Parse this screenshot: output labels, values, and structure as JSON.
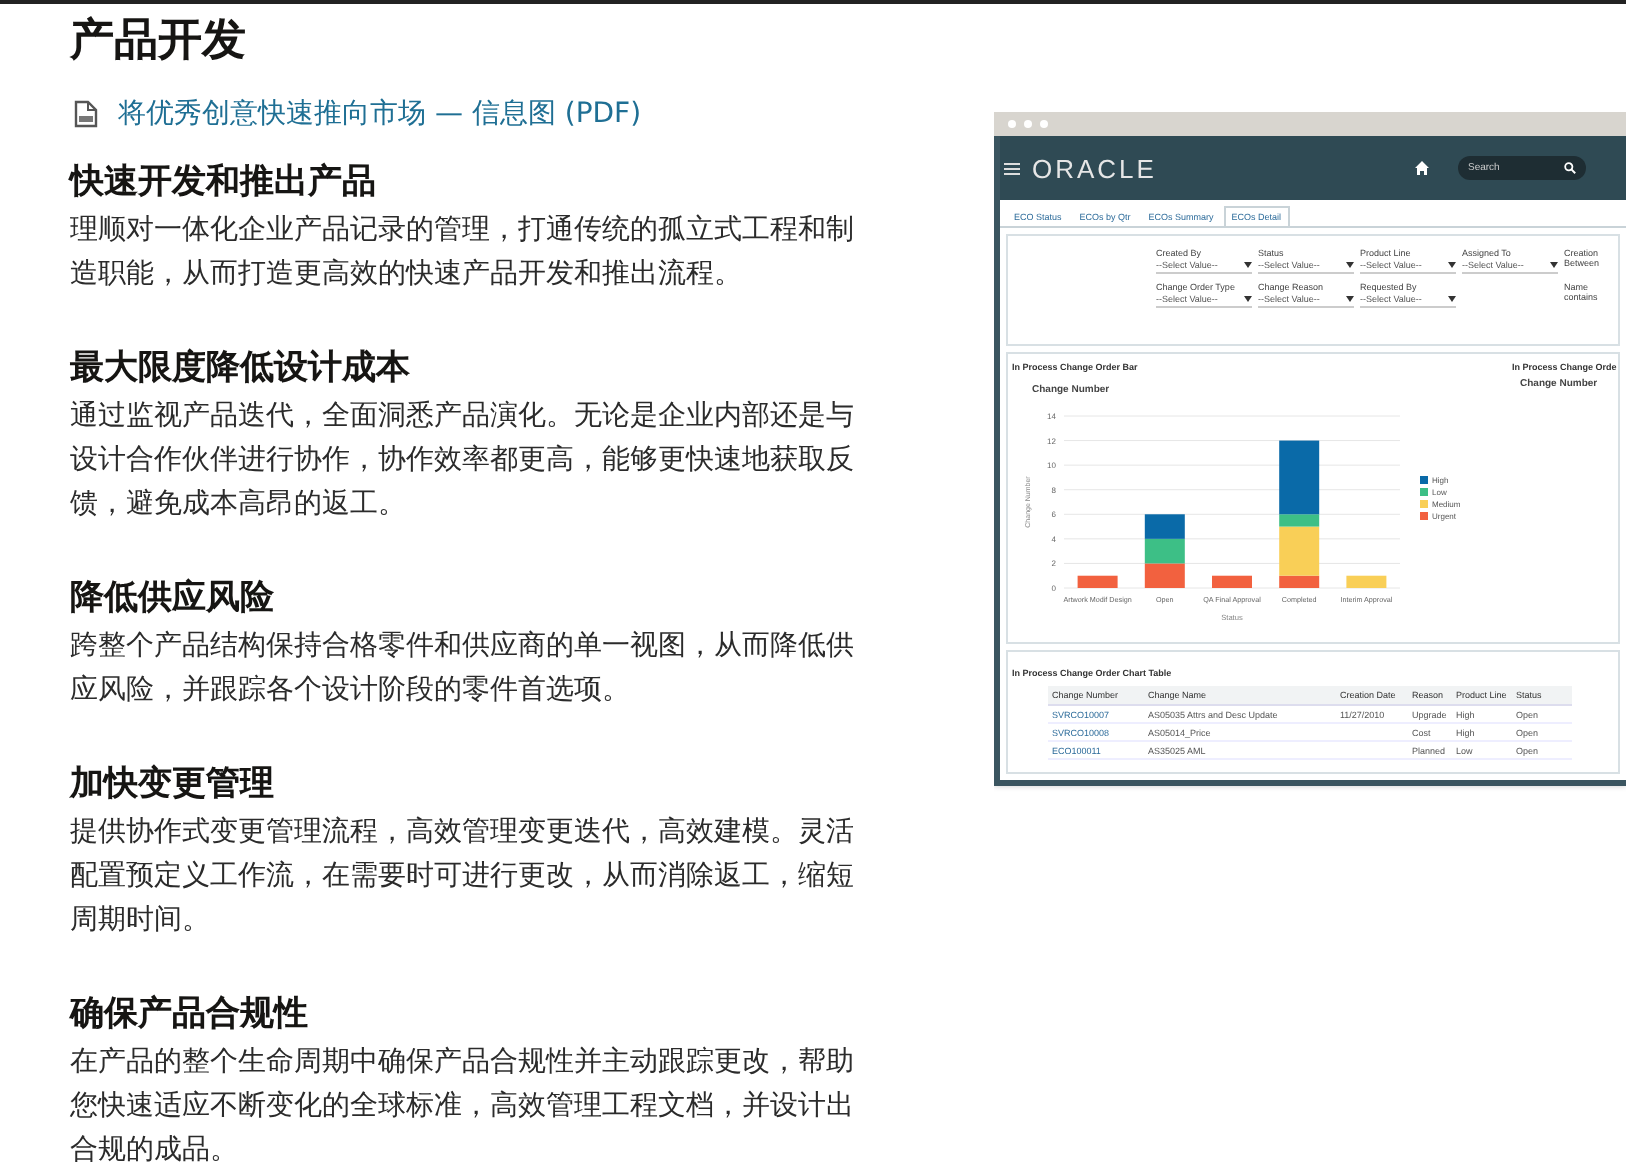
{
  "page": {
    "title": "产品开发",
    "pdf_link": "将优秀创意快速推向市场 — 信息图 (PDF)"
  },
  "sections": [
    {
      "heading": "快速开发和推出产品",
      "body": "理顺对一体化企业产品记录的管理，打通传统的孤立式工程和制造职能，从而打造更高效的快速产品开发和推出流程。"
    },
    {
      "heading": "最大限度降低设计成本",
      "body": "通过监视产品迭代，全面洞悉产品演化。无论是企业内部还是与设计合作伙伴进行协作，协作效率都更高，能够更快速地获取反馈，避免成本高昂的返工。"
    },
    {
      "heading": "降低供应风险",
      "body": "跨整个产品结构保持合格零件和供应商的单一视图，从而降低供应风险，并跟踪各个设计阶段的零件首选项。"
    },
    {
      "heading": "加快变更管理",
      "body": "提供协作式变更管理流程，高效管理变更迭代，高效建模。灵活配置预定义工作流，在需要时可进行更改，从而消除返工，缩短周期时间。"
    },
    {
      "heading": "确保产品合规性",
      "body": "在产品的整个生命周期中确保产品合规性并主动跟踪更改，帮助您快速适应不断变化的全球标准，高效管理工程文档，并设计出合规的成品。"
    }
  ],
  "mockup": {
    "logo": "ORACLE",
    "search": {
      "placeholder": "Search"
    },
    "tabs": [
      {
        "label": "ECO Status",
        "selected": false
      },
      {
        "label": "ECOs by Qtr",
        "selected": false
      },
      {
        "label": "ECOs Summary",
        "selected": false
      },
      {
        "label": "ECOs Detail",
        "selected": true
      }
    ],
    "filters": [
      {
        "kind": "select",
        "label": "Created By",
        "value": "--Select Value--"
      },
      {
        "kind": "select",
        "label": "Status",
        "value": "--Select Value--"
      },
      {
        "kind": "select",
        "label": "Product Line",
        "value": "--Select Value--"
      },
      {
        "kind": "select",
        "label": "Assigned To",
        "value": "--Select Value--"
      },
      {
        "kind": "text",
        "label": "Creation",
        "value": "Between"
      },
      {
        "kind": "select",
        "label": "Change Order Type",
        "value": "--Select Value--"
      },
      {
        "kind": "select",
        "label": "Change Reason",
        "value": "--Select Value--"
      },
      {
        "kind": "select",
        "label": "Requested By",
        "value": "--Select Value--"
      },
      {
        "kind": "empty"
      },
      {
        "kind": "text",
        "label": "Name",
        "value": "contains"
      }
    ],
    "chart_panel": {
      "title": "In Process Change Order Bar",
      "chart_data": {
        "type": "bar",
        "title": "Change Number",
        "xlabel": "Status",
        "ylabel": "Change Number",
        "stacked": true,
        "categories": [
          "Artwork Modif Design",
          "Open",
          "QA Final Approval",
          "Completed",
          "Interim Approval"
        ],
        "series": [
          {
            "name": "Urgent",
            "color": "#f2613f",
            "values": [
              1,
              2,
              1,
              1,
              0
            ]
          },
          {
            "name": "Medium",
            "color": "#f9cf57",
            "values": [
              0,
              0,
              0,
              4,
              1
            ]
          },
          {
            "name": "Low",
            "color": "#3dbf86",
            "values": [
              0,
              2,
              0,
              1,
              0
            ]
          },
          {
            "name": "High",
            "color": "#0a6aa8",
            "values": [
              0,
              2,
              0,
              6,
              0
            ]
          }
        ],
        "ylim": [
          0,
          14
        ],
        "grid": true,
        "legend": true,
        "yticks": [
          0,
          2,
          4,
          6,
          8,
          10,
          12,
          14
        ]
      }
    },
    "side_panel": {
      "title": "In Process Change Orde",
      "subtitle": "Change Number"
    },
    "table": {
      "title": "In Process Change Order Chart Table",
      "columns": [
        "Change Number",
        "Change Name",
        "Creation Date",
        "Reason",
        "Product Line",
        "Status"
      ],
      "rows": [
        {
          "change_number": "SVRCO10007",
          "change_name": "AS05035 Attrs and Desc Update",
          "creation_date": "11/27/2010",
          "reason": "Upgrade",
          "product_line": "High",
          "status": "Open"
        },
        {
          "change_number": "SVRCO10008",
          "change_name": "AS05014_Price",
          "reason": "Cost",
          "product_line": "High",
          "status": "Open"
        },
        {
          "change_number": "ECO100011",
          "change_name": "AS35025 AML",
          "reason": "Planned",
          "product_line": "Low",
          "status": "Open"
        }
      ]
    }
  }
}
